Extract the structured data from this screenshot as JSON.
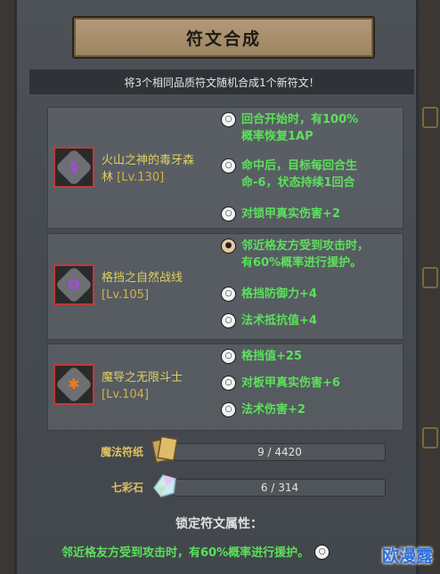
{
  "title": "符文合成",
  "info": "将3个相同品质符文随机合成1个新符文！",
  "runes": [
    {
      "name": "火山之神的毒牙森林",
      "name_line1": "火山之神的毒牙森",
      "name_line2": "林",
      "level": "[Lv.130]",
      "glyph": "§",
      "glyph_color": "#a44be0",
      "attributes": [
        {
          "line1": "回合开始时，有100%",
          "line2": "概率恢复1AP",
          "locked": false
        },
        {
          "line1": "命中后，目标每回合生",
          "line2": "命-6，状态持续1回合",
          "locked": false
        },
        {
          "line1": "对锁甲真实伤害+2",
          "line2": "",
          "locked": false
        }
      ]
    },
    {
      "name": "格挡之自然战线",
      "name_line1": "格挡之自然战线",
      "name_line2": "",
      "level": "[Lv.105]",
      "glyph": "ʘ",
      "glyph_color": "#a44be0",
      "attributes": [
        {
          "line1": "邻近格友方受到攻击时，",
          "line2": "有60%概率进行援护。",
          "locked": true
        },
        {
          "line1": "格挡防御力+4",
          "line2": "",
          "locked": false
        },
        {
          "line1": "法术抵抗值+4",
          "line2": "",
          "locked": false
        }
      ]
    },
    {
      "name": "魔导之无限斗士",
      "name_line1": "魔导之无限斗士",
      "name_line2": "",
      "level": "[Lv.104]",
      "glyph": "✱",
      "glyph_color": "#f07a1c",
      "attributes": [
        {
          "line1": "格挡值+25",
          "line2": "",
          "locked": false
        },
        {
          "line1": "对板甲真实伤害+6",
          "line2": "",
          "locked": false
        },
        {
          "line1": "法术伤害+2",
          "line2": "",
          "locked": false
        }
      ]
    }
  ],
  "resources": [
    {
      "label": "魔法符纸",
      "value": "9 / 4420",
      "icon": "magic-paper-icon"
    },
    {
      "label": "七彩石",
      "value": "6 / 314",
      "icon": "rainbow-stone-icon"
    }
  ],
  "locked_attr_title": "锁定符文属性：",
  "locked_attr_desc": "邻近格友方受到攻击时，有60%概率进行援护。",
  "watermark": "欧漫露"
}
